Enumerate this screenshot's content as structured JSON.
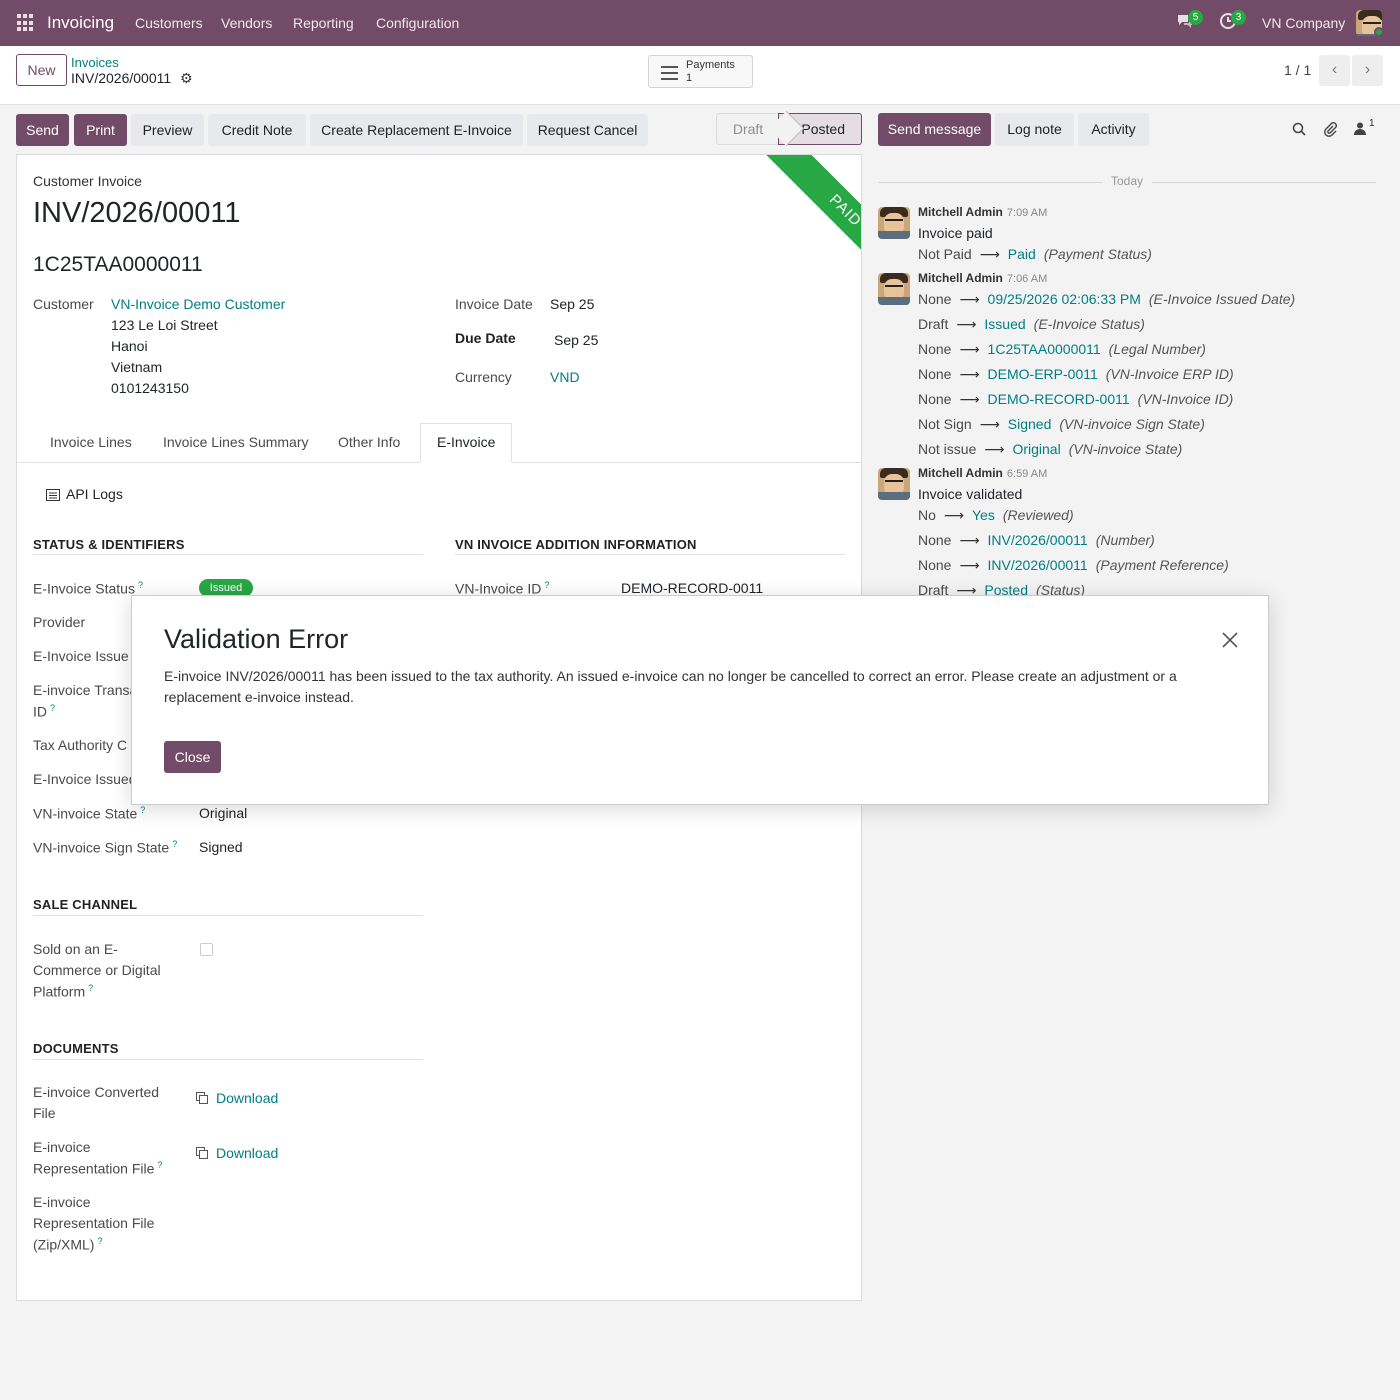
{
  "nav": {
    "app_name": "Invoicing",
    "menus": [
      "Customers",
      "Vendors",
      "Reporting",
      "Configuration"
    ],
    "messages_count": "5",
    "activities_count": "3",
    "company": "VN Company"
  },
  "control": {
    "new_label": "New",
    "breadcrumb_parent": "Invoices",
    "breadcrumb_current": "INV/2026/00011",
    "payments_label": "Payments",
    "payments_count": "1",
    "pager": "1 / 1"
  },
  "actions": {
    "send": "Send",
    "print": "Print",
    "preview": "Preview",
    "credit_note": "Credit Note",
    "replacement": "Create Replacement E-Invoice",
    "request_cancel": "Request Cancel"
  },
  "status": {
    "draft": "Draft",
    "posted": "Posted"
  },
  "invoice": {
    "type": "Customer Invoice",
    "name": "INV/2026/00011",
    "legal_number": "1C25TAA0000011",
    "ribbon": "PAID",
    "customer_label": "Customer",
    "customer_name": "VN-Invoice Demo Customer",
    "address": [
      "123 Le Loi Street",
      "Hanoi",
      "Vietnam",
      "0101243150"
    ],
    "invoice_date_label": "Invoice Date",
    "invoice_date": "Sep 25",
    "due_date_label": "Due Date",
    "due_date": "Sep 25",
    "currency_label": "Currency",
    "currency": "VND"
  },
  "tabs": [
    "Invoice Lines",
    "Invoice Lines Summary",
    "Other Info",
    "E-Invoice"
  ],
  "einvoice": {
    "api_logs": "API Logs",
    "status_section": "STATUS & IDENTIFIERS",
    "addition_section": "VN INVOICE ADDITION INFORMATION",
    "status_label": "E-Invoice Status",
    "status_value": "Issued",
    "provider_label": "Provider",
    "issue_label": "E-Invoice Issue",
    "transaction_label_1": "E-invoice Transa",
    "transaction_label_2": "ID",
    "tax_authority_label": "Tax Authority C",
    "issued_label": "E-Invoice Issued",
    "vn_state_label": "VN-invoice State",
    "vn_state_value": "Original",
    "sign_state_label": "VN-invoice Sign State",
    "sign_state_value": "Signed",
    "vn_invoice_id_label": "VN-Invoice ID",
    "vn_invoice_id_value": "DEMO-RECORD-0011",
    "sale_channel_section": "SALE CHANNEL",
    "sold_label": [
      "Sold on an E-",
      "Commerce or Digital",
      "Platform"
    ],
    "documents_section": "DOCUMENTS",
    "converted_label": [
      "E-invoice Converted",
      "File"
    ],
    "representation_label": [
      "E-invoice",
      "Representation File"
    ],
    "representation_zip_label": [
      "E-invoice",
      "Representation File",
      "(Zip/XML)"
    ],
    "download": "Download"
  },
  "chatter": {
    "send_message": "Send message",
    "log_note": "Log note",
    "activity": "Activity",
    "followers_count": "1",
    "today": "Today",
    "messages": [
      {
        "author": "Mitchell Admin",
        "time": "7:09 AM",
        "text": "Invoice paid",
        "tracking": [
          {
            "old": "Not Paid",
            "new": "Paid",
            "field": "(Payment Status)"
          }
        ]
      },
      {
        "author": "Mitchell Admin",
        "time": "7:06 AM",
        "text": "",
        "tracking": [
          {
            "old": "None",
            "new": "09/25/2026 02:06:33 PM",
            "field": "(E-Invoice Issued Date)"
          },
          {
            "old": "Draft",
            "new": "Issued",
            "field": "(E-Invoice Status)"
          },
          {
            "old": "None",
            "new": "1C25TAA0000011",
            "field": "(Legal Number)"
          },
          {
            "old": "None",
            "new": "DEMO-ERP-0011",
            "field": "(VN-Invoice ERP ID)"
          },
          {
            "old": "None",
            "new": "DEMO-RECORD-0011",
            "field": "(VN-Invoice ID)"
          },
          {
            "old": "Not Sign",
            "new": "Signed",
            "field": "(VN-invoice Sign State)"
          },
          {
            "old": "Not issue",
            "new": "Original",
            "field": "(VN-invoice State)"
          }
        ]
      },
      {
        "author": "Mitchell Admin",
        "time": "6:59 AM",
        "text": "Invoice validated",
        "tracking": [
          {
            "old": "No",
            "new": "Yes",
            "field": "(Reviewed)"
          },
          {
            "old": "None",
            "new": "INV/2026/00011",
            "field": "(Number)"
          },
          {
            "old": "None",
            "new": "INV/2026/00011",
            "field": "(Payment Reference)"
          },
          {
            "old": "Draft",
            "new": "Posted",
            "field": "(Status)"
          }
        ]
      }
    ]
  },
  "dialog": {
    "title": "Validation Error",
    "body": "E-invoice INV/2026/00011 has been issued to the tax authority. An issued e-invoice can no longer be cancelled to correct an error. Please create an adjustment or a replacement e-invoice instead.",
    "close_label": "Close"
  },
  "colors": {
    "brand": "#714b67",
    "link": "#017e84",
    "success": "#28a745"
  }
}
